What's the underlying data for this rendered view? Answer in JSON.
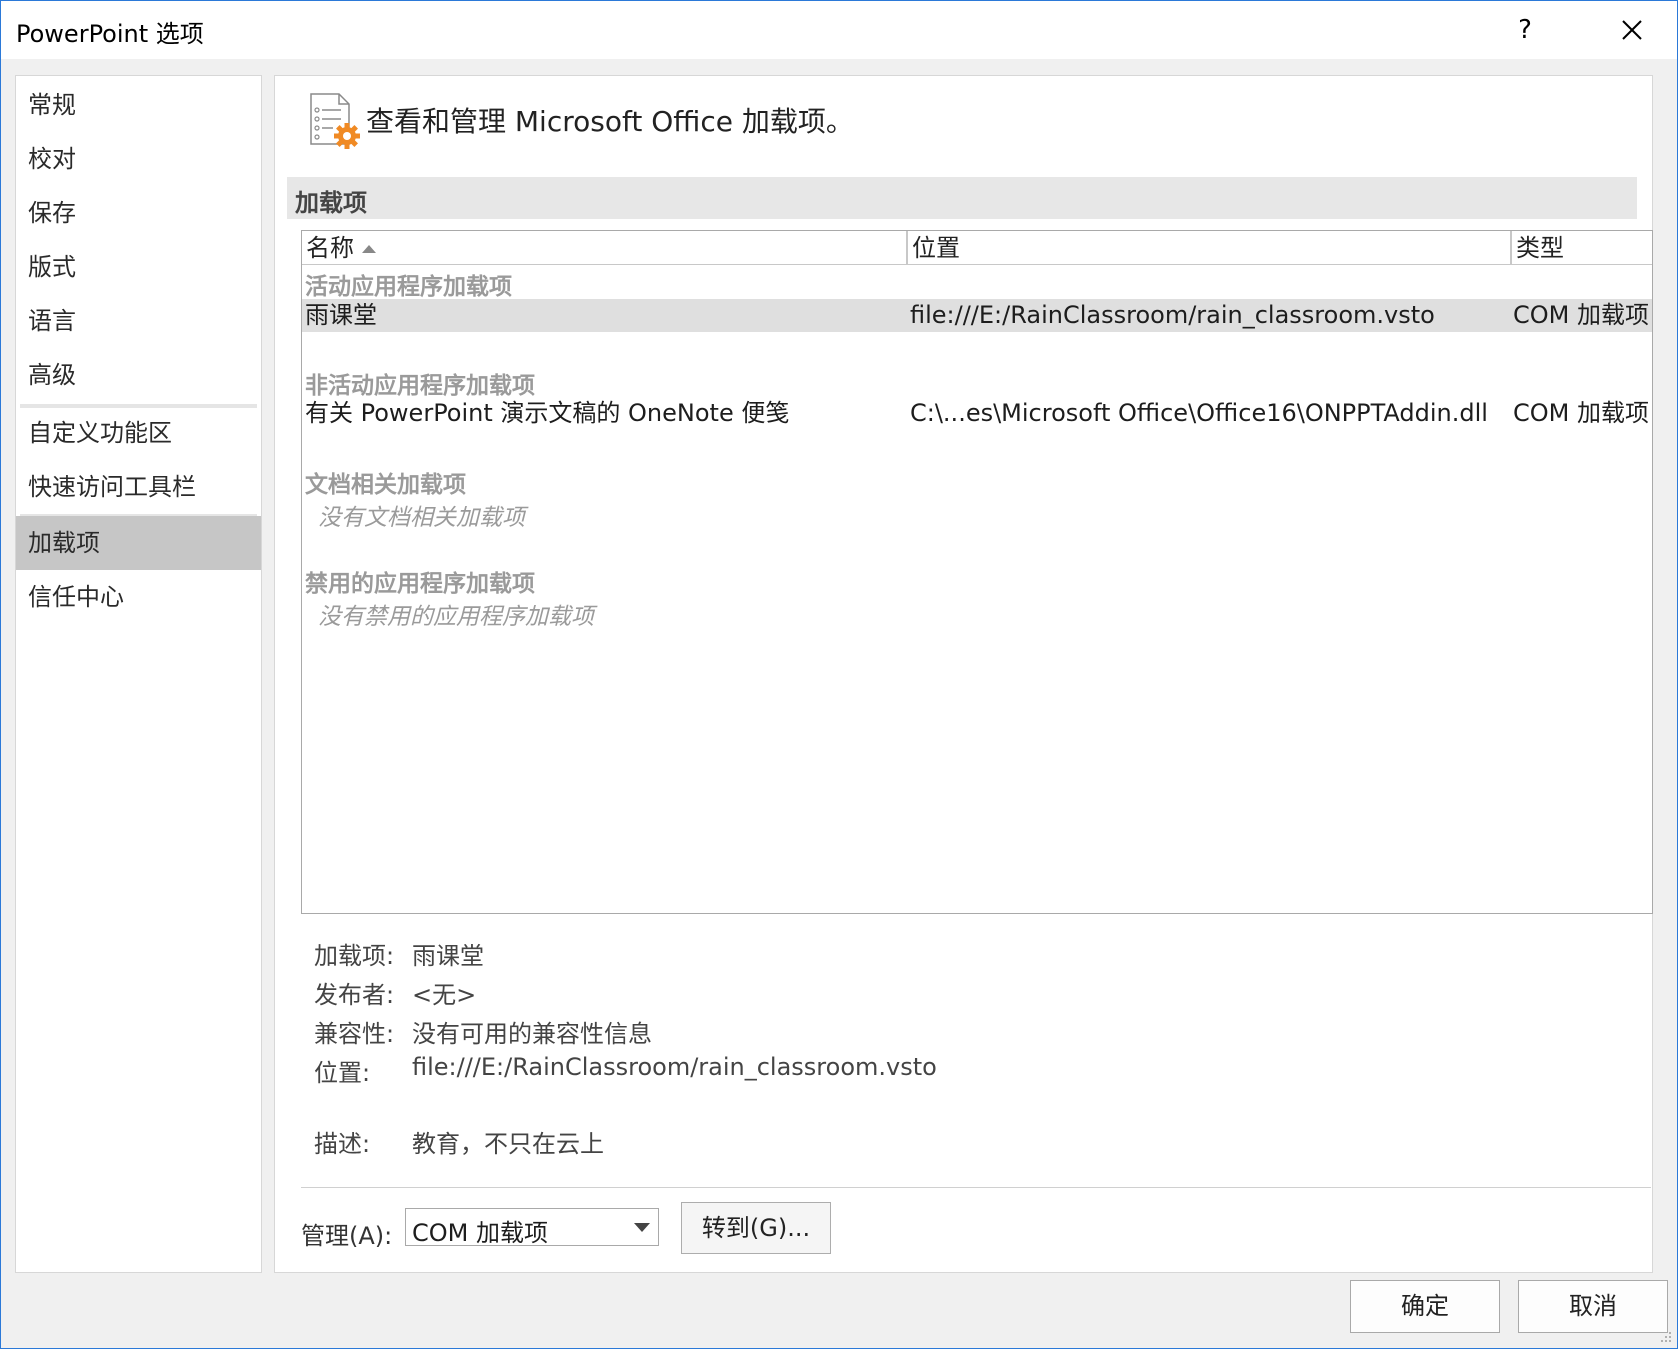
{
  "window": {
    "title": "PowerPoint 选项",
    "help_label": "?"
  },
  "sidebar": {
    "items": [
      {
        "label": "常规"
      },
      {
        "label": "校对"
      },
      {
        "label": "保存"
      },
      {
        "label": "版式"
      },
      {
        "label": "语言"
      },
      {
        "label": "高级"
      },
      {
        "label": "自定义功能区"
      },
      {
        "label": "快速访问工具栏"
      },
      {
        "label": "加载项",
        "selected": true
      },
      {
        "label": "信任中心"
      }
    ]
  },
  "main": {
    "header": "查看和管理 Microsoft Office 加载项。",
    "section_title": "加载项",
    "columns": {
      "name": "名称",
      "location": "位置",
      "type": "类型"
    },
    "groups": {
      "active": {
        "label": "活动应用程序加载项",
        "rows": [
          {
            "name": "雨课堂",
            "location": "file:///E:/RainClassroom/rain_classroom.vsto",
            "type": "COM 加载项"
          }
        ]
      },
      "inactive": {
        "label": "非活动应用程序加载项",
        "rows": [
          {
            "name": "有关 PowerPoint 演示文稿的 OneNote 便笺",
            "location": "C:\\...es\\Microsoft Office\\Office16\\ONPPTAddin.dll",
            "type": "COM 加载项"
          }
        ]
      },
      "document": {
        "label": "文档相关加载项",
        "empty": "没有文档相关加载项"
      },
      "disabled": {
        "label": "禁用的应用程序加载项",
        "empty": "没有禁用的应用程序加载项"
      }
    },
    "details": {
      "addin_label": "加载项:",
      "addin_value": "雨课堂",
      "publisher_label": "发布者:",
      "publisher_value": "<无>",
      "compat_label": "兼容性:",
      "compat_value": "没有可用的兼容性信息",
      "location_label": "位置:",
      "location_value": "file:///E:/RainClassroom/rain_classroom.vsto",
      "desc_label": "描述:",
      "desc_value": "教育，不只在云上"
    },
    "manage": {
      "label": "管理(A):",
      "selected": "COM 加载项",
      "goto_label": "转到(G)..."
    }
  },
  "footer": {
    "ok_label": "确定",
    "cancel_label": "取消"
  },
  "colors": {
    "window_border": "#2b79d8",
    "selected_nav": "#c6c6c6",
    "icon_gear": "#f08a24"
  }
}
